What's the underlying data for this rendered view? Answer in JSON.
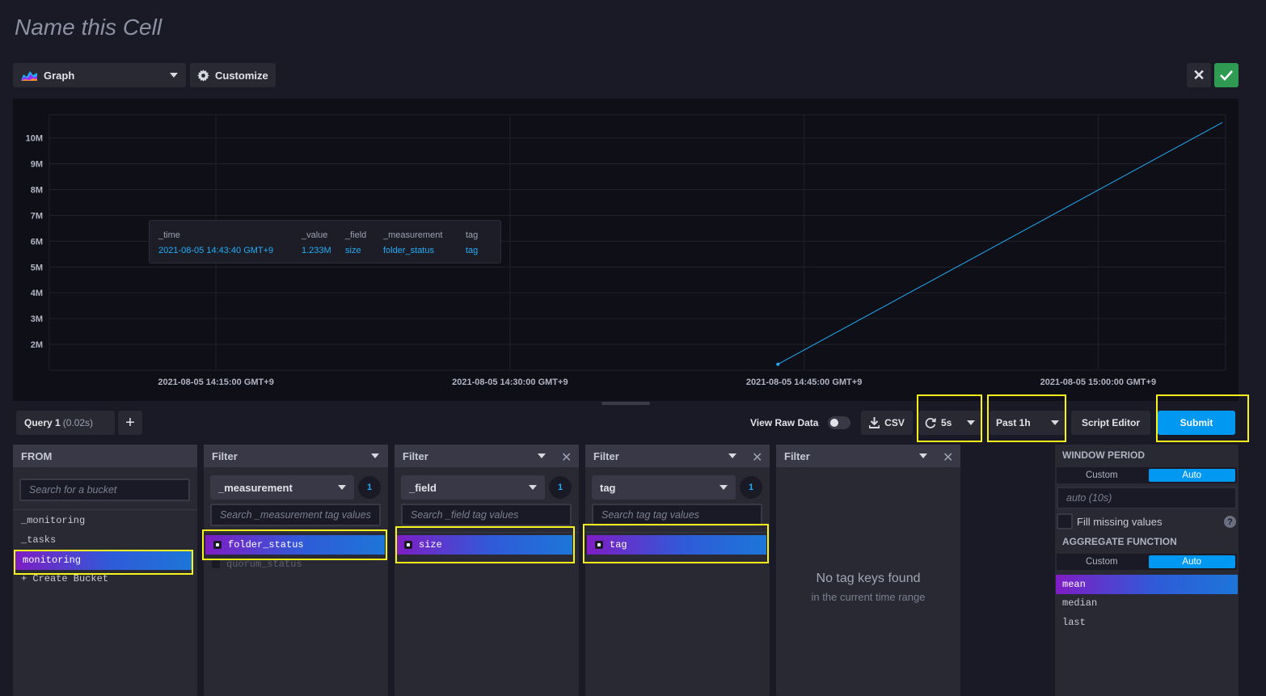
{
  "cell": {
    "title": "Name this Cell"
  },
  "toolbar": {
    "viz_type": "Graph",
    "customize_label": "Customize",
    "cancel_icon": "close-icon",
    "confirm_icon": "check-icon",
    "confirm_color": "#2f9a52"
  },
  "chart_data": {
    "type": "line",
    "title": "",
    "xlabel": "",
    "ylabel": "",
    "x_ticks": [
      "2021-08-05 14:15:00 GMT+9",
      "2021-08-05 14:30:00 GMT+9",
      "2021-08-05 14:45:00 GMT+9",
      "2021-08-05 15:00:00 GMT+9"
    ],
    "y_ticks": [
      "10M",
      "9M",
      "8M",
      "7M",
      "6M",
      "5M",
      "4M",
      "3M",
      "2M"
    ],
    "ylim": [
      1000000,
      10900000
    ],
    "xlim": [
      "2021-08-05 14:06:30 GMT+9",
      "2021-08-05 15:06:30 GMT+9"
    ],
    "grid": true,
    "series": [
      {
        "color": "#22adf6",
        "x": [
          "2021-08-05 14:43:40 GMT+9",
          "2021-08-05 15:06:20 GMT+9"
        ],
        "y": [
          1233000,
          10600000
        ]
      }
    ],
    "tooltip": {
      "headers": [
        "_time",
        "_value",
        "_field",
        "_measurement",
        "tag"
      ],
      "values": [
        "2021-08-05 14:43:40 GMT+9",
        "1.233M",
        "size",
        "folder_status",
        "tag"
      ]
    }
  },
  "query_bar": {
    "tab_label": "Query 1",
    "tab_duration": "(0.02s)",
    "add_label": "+",
    "view_raw_label": "View Raw Data",
    "csv_label": "CSV",
    "refresh_label": "5s",
    "time_range_label": "Past 1h",
    "script_editor_label": "Script Editor",
    "submit_label": "Submit",
    "submit_color": "#0098f0"
  },
  "from_panel": {
    "header": "FROM",
    "search_placeholder": "Search for a bucket",
    "buckets": [
      "_monitoring",
      "_tasks",
      "monitoring",
      "+ Create Bucket"
    ]
  },
  "filters": [
    {
      "header": "Filter",
      "key": "_measurement",
      "count": "1",
      "search_placeholder": "Search _measurement tag values",
      "values": [
        "folder_status",
        "quorum_status"
      ]
    },
    {
      "header": "Filter",
      "key": "_field",
      "count": "1",
      "search_placeholder": "Search _field tag values",
      "values": [
        "size"
      ]
    },
    {
      "header": "Filter",
      "key": "tag",
      "count": "1",
      "search_placeholder": "Search tag tag values",
      "values": [
        "tag"
      ]
    },
    {
      "header": "Filter",
      "empty_title": "No tag keys found",
      "empty_sub": "in the current time range"
    }
  ],
  "window_panel": {
    "window_period_title": "WINDOW PERIOD",
    "custom_label": "Custom",
    "auto_label": "Auto",
    "period_placeholder": "auto (10s)",
    "fill_missing_label": "Fill missing values",
    "help_label": "?",
    "aggregate_title": "AGGREGATE FUNCTION",
    "functions": [
      "mean",
      "median",
      "last"
    ]
  }
}
